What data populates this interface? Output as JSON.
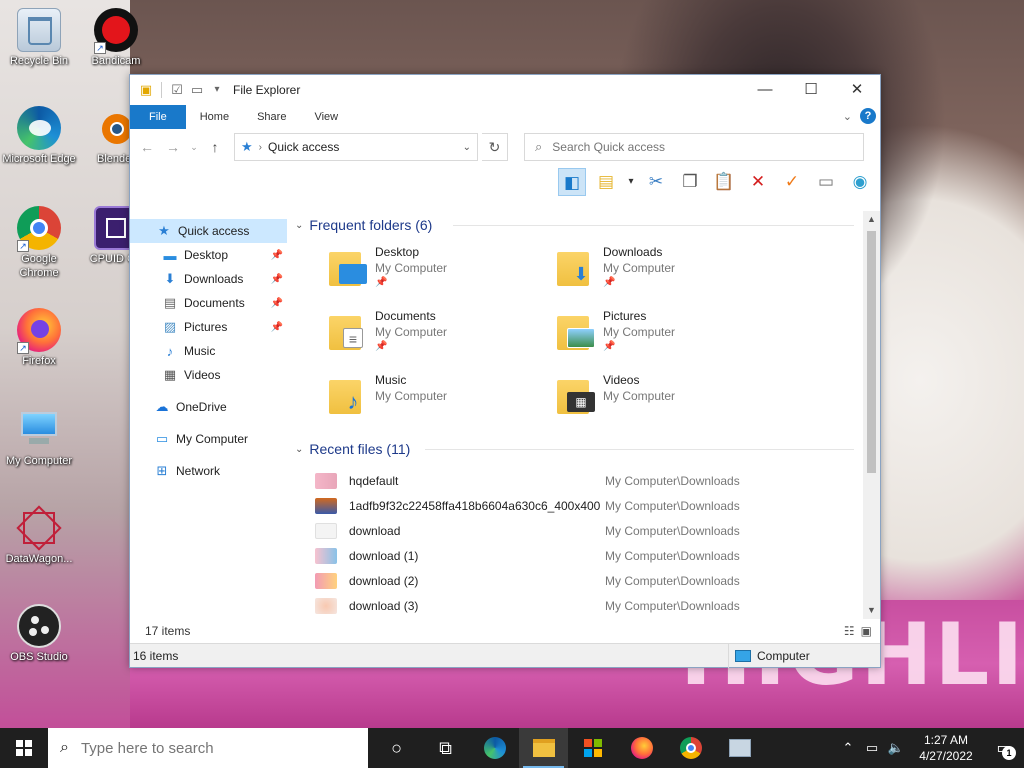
{
  "desktop": {
    "wallpaper_text": "HIGHLIGH",
    "icons": [
      {
        "label": "Recycle Bin",
        "icon": "recycle-bin-icon"
      },
      {
        "label": "Bandicam",
        "icon": "bandicam-icon"
      },
      {
        "label": "Microsoft Edge",
        "icon": "edge-icon"
      },
      {
        "label": "Blender",
        "icon": "blender-icon"
      },
      {
        "label": "Google Chrome",
        "icon": "chrome-icon"
      },
      {
        "label": "CPUID CP",
        "icon": "cpuid-icon"
      },
      {
        "label": "Firefox",
        "icon": "firefox-icon"
      },
      {
        "label": "My Computer",
        "icon": "computer-icon"
      },
      {
        "label": "DataWagon...",
        "icon": "datawagon-icon"
      },
      {
        "label": "OBS Studio",
        "icon": "obs-icon"
      }
    ]
  },
  "window": {
    "title": "File Explorer",
    "controls": {
      "minimize": "—",
      "maximize": "☐",
      "close": "✕"
    },
    "ribbon_tabs": [
      "File",
      "Home",
      "Share",
      "View"
    ],
    "help": "?",
    "address": {
      "crumb": "Quick access"
    },
    "search": {
      "placeholder": "Search Quick access"
    }
  },
  "nav": {
    "items": [
      {
        "label": "Quick access",
        "selected": true
      },
      {
        "label": "Desktop",
        "pinned": true
      },
      {
        "label": "Downloads",
        "pinned": true
      },
      {
        "label": "Documents",
        "pinned": true
      },
      {
        "label": "Pictures",
        "pinned": true
      },
      {
        "label": "Music"
      },
      {
        "label": "Videos"
      },
      {
        "label": "OneDrive"
      },
      {
        "label": "My Computer"
      },
      {
        "label": "Network"
      }
    ]
  },
  "frequent": {
    "header": "Frequent folders (6)",
    "folders": [
      {
        "name": "Desktop",
        "location": "My Computer",
        "pinned": true
      },
      {
        "name": "Downloads",
        "location": "My Computer",
        "pinned": true
      },
      {
        "name": "Documents",
        "location": "My Computer",
        "pinned": true
      },
      {
        "name": "Pictures",
        "location": "My Computer",
        "pinned": true
      },
      {
        "name": "Music",
        "location": "My Computer",
        "pinned": false
      },
      {
        "name": "Videos",
        "location": "My Computer",
        "pinned": false
      }
    ]
  },
  "recent": {
    "header": "Recent files (11)",
    "files": [
      {
        "name": "hqdefault",
        "path": "My Computer\\Downloads"
      },
      {
        "name": "1adfb9f32c22458ffa418b6604a630c6_400x400",
        "path": "My Computer\\Downloads"
      },
      {
        "name": "download",
        "path": "My Computer\\Downloads"
      },
      {
        "name": "download (1)",
        "path": "My Computer\\Downloads"
      },
      {
        "name": "download (2)",
        "path": "My Computer\\Downloads"
      },
      {
        "name": "download (3)",
        "path": "My Computer\\Downloads"
      }
    ]
  },
  "status": {
    "items_count": "17 items",
    "outer_count": "16 items",
    "location": "Computer"
  },
  "taskbar": {
    "search_placeholder": "Type here to search",
    "time": "1:27 AM",
    "date": "4/27/2022",
    "notifications": "1"
  }
}
